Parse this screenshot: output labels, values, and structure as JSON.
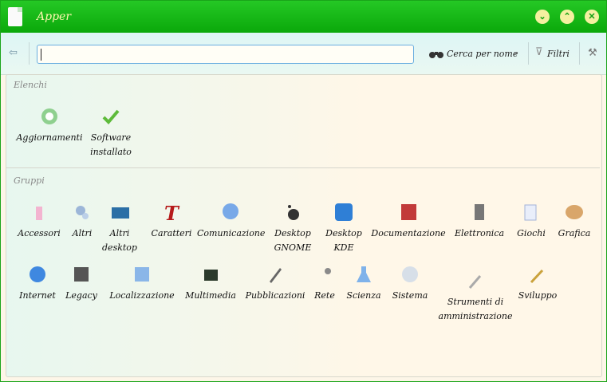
{
  "window": {
    "title": "Apper"
  },
  "toolbar": {
    "search_value": "",
    "search_by_name_label": "Cerca per nome",
    "filters_label": "Filtri"
  },
  "sections": {
    "lists_title": "Elenchi",
    "groups_title": "Gruppi"
  },
  "lists": [
    {
      "label": "Aggiornamenti",
      "icon": "updates-gear-icon"
    },
    {
      "label": "Software\ninstallato",
      "icon": "checkmark-icon"
    }
  ],
  "groups": [
    {
      "label": "Accessori",
      "icon": "accessories-icon"
    },
    {
      "label": "Altri",
      "icon": "other-icon"
    },
    {
      "label": "Altri\ndesktop",
      "icon": "desktop-icon"
    },
    {
      "label": "Caratteri",
      "icon": "fonts-icon"
    },
    {
      "label": "Comunicazione",
      "icon": "communication-icon"
    },
    {
      "label": "Desktop\nGNOME",
      "icon": "gnome-foot-icon"
    },
    {
      "label": "Desktop\nKDE",
      "icon": "kde-icon"
    },
    {
      "label": "Documentazione",
      "icon": "book-icon"
    },
    {
      "label": "Elettronica",
      "icon": "electronics-icon"
    },
    {
      "label": "Giochi",
      "icon": "cards-icon"
    },
    {
      "label": "Grafica",
      "icon": "palette-icon"
    },
    {
      "label": "Internet",
      "icon": "globe-icon"
    },
    {
      "label": "Legacy",
      "icon": "floppy-icon"
    },
    {
      "label": "Localizzazione",
      "icon": "localization-icon"
    },
    {
      "label": "Multimedia",
      "icon": "multimedia-icon"
    },
    {
      "label": "Pubblicazioni",
      "icon": "publishing-icon"
    },
    {
      "label": "Rete",
      "icon": "network-icon"
    },
    {
      "label": "Scienza",
      "icon": "flask-icon"
    },
    {
      "label": "Sistema",
      "icon": "system-gear-icon"
    },
    {
      "label": "Strumenti di\namministrazione",
      "icon": "admin-tools-icon"
    },
    {
      "label": "Sviluppo",
      "icon": "hammer-icon"
    }
  ]
}
